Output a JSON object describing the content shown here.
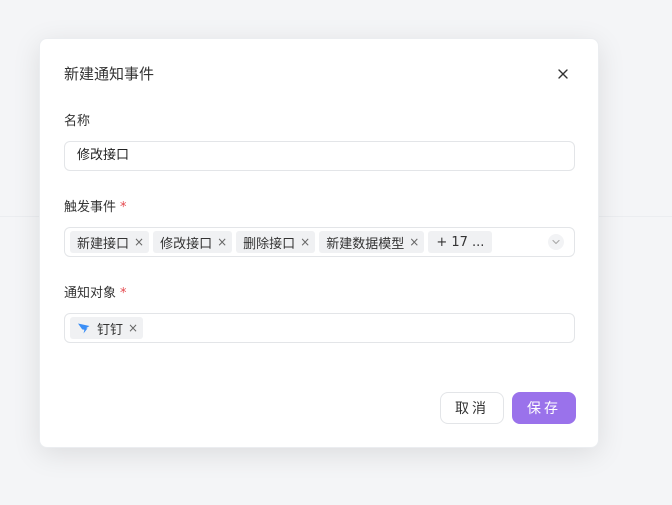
{
  "dialog": {
    "title": "新建通知事件",
    "close_icon": "close-icon"
  },
  "fields": {
    "name": {
      "label": "名称",
      "value": "修改接口"
    },
    "trigger_events": {
      "label": "触发事件",
      "required_mark": "*",
      "tags": [
        "新建接口",
        "修改接口",
        "删除接口",
        "新建数据模型"
      ],
      "more_label": "+ 17 ...",
      "tag_close": "×",
      "arrow_icon": "chevron-down-icon"
    },
    "notify_targets": {
      "label": "通知对象",
      "required_mark": "*",
      "tags": [
        {
          "icon": "dingtalk-icon",
          "label": "钉钉"
        }
      ],
      "tag_close": "×"
    }
  },
  "footer": {
    "cancel_label": "取消",
    "save_label": "保存"
  },
  "colors": {
    "primary": "#9a72eb",
    "required": "#e5484d",
    "dingtalk": "#3a8ef6"
  }
}
